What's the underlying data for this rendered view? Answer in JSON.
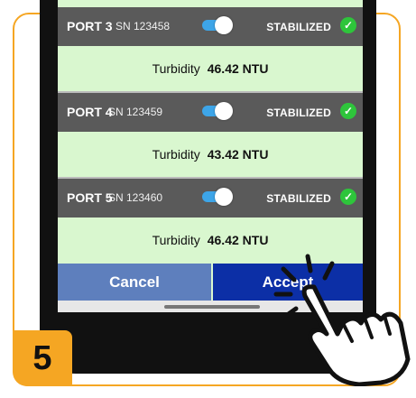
{
  "ports": [
    {
      "name": "PORT 3",
      "sn": "SN 123458",
      "status": "STABILIZED",
      "reading_label": "Turbidity",
      "reading_value": "46.42 NTU"
    },
    {
      "name": "PORT 4",
      "sn": "SN 123459",
      "status": "STABILIZED",
      "reading_label": "Turbidity",
      "reading_value": "43.42 NTU"
    },
    {
      "name": "PORT 5",
      "sn": "SN 123460",
      "status": "STABILIZED",
      "reading_label": "Turbidity",
      "reading_value": "46.42 NTU"
    }
  ],
  "buttons": {
    "cancel_label": "Cancel",
    "accept_label": "Accept"
  },
  "step_number": "5",
  "icons": {
    "check": "check-icon",
    "toggle": "toggle-switch",
    "hand": "tap-hand-icon"
  },
  "colors": {
    "accent": "#f5a623",
    "header": "#5a5a5a",
    "body": "#d9f7cf",
    "toggle": "#3da5e8",
    "check": "#2ec53b",
    "cancel": "#5e7fbd",
    "accept": "#0c2fa6"
  }
}
